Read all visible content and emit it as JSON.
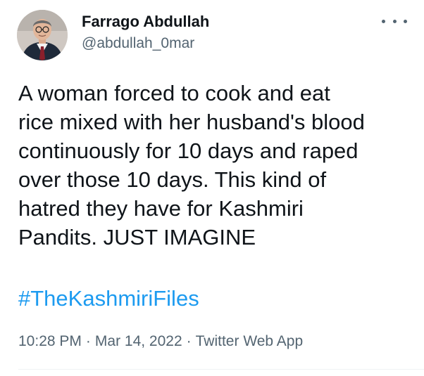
{
  "tweet": {
    "author": {
      "display_name": "Farrago Abdullah",
      "handle": "@abdullah_0mar"
    },
    "text_lines": [
      "A woman forced to cook and eat",
      "rice mixed with her husband's blood",
      "continuously for 10 days and raped",
      "over those 10 days. This kind of",
      "hatred they have for Kashmiri",
      "Pandits. JUST IMAGINE"
    ],
    "hashtag": "#TheKashmiriFiles",
    "time": "10:28 PM",
    "date": "Mar 14, 2022",
    "source": "Twitter Web App",
    "separator": "·"
  },
  "icons": {
    "more": "more-horizontal-icon"
  },
  "colors": {
    "text": "#0f1419",
    "secondary": "#536471",
    "link": "#1d9bf0",
    "divider": "#eff3f4"
  }
}
